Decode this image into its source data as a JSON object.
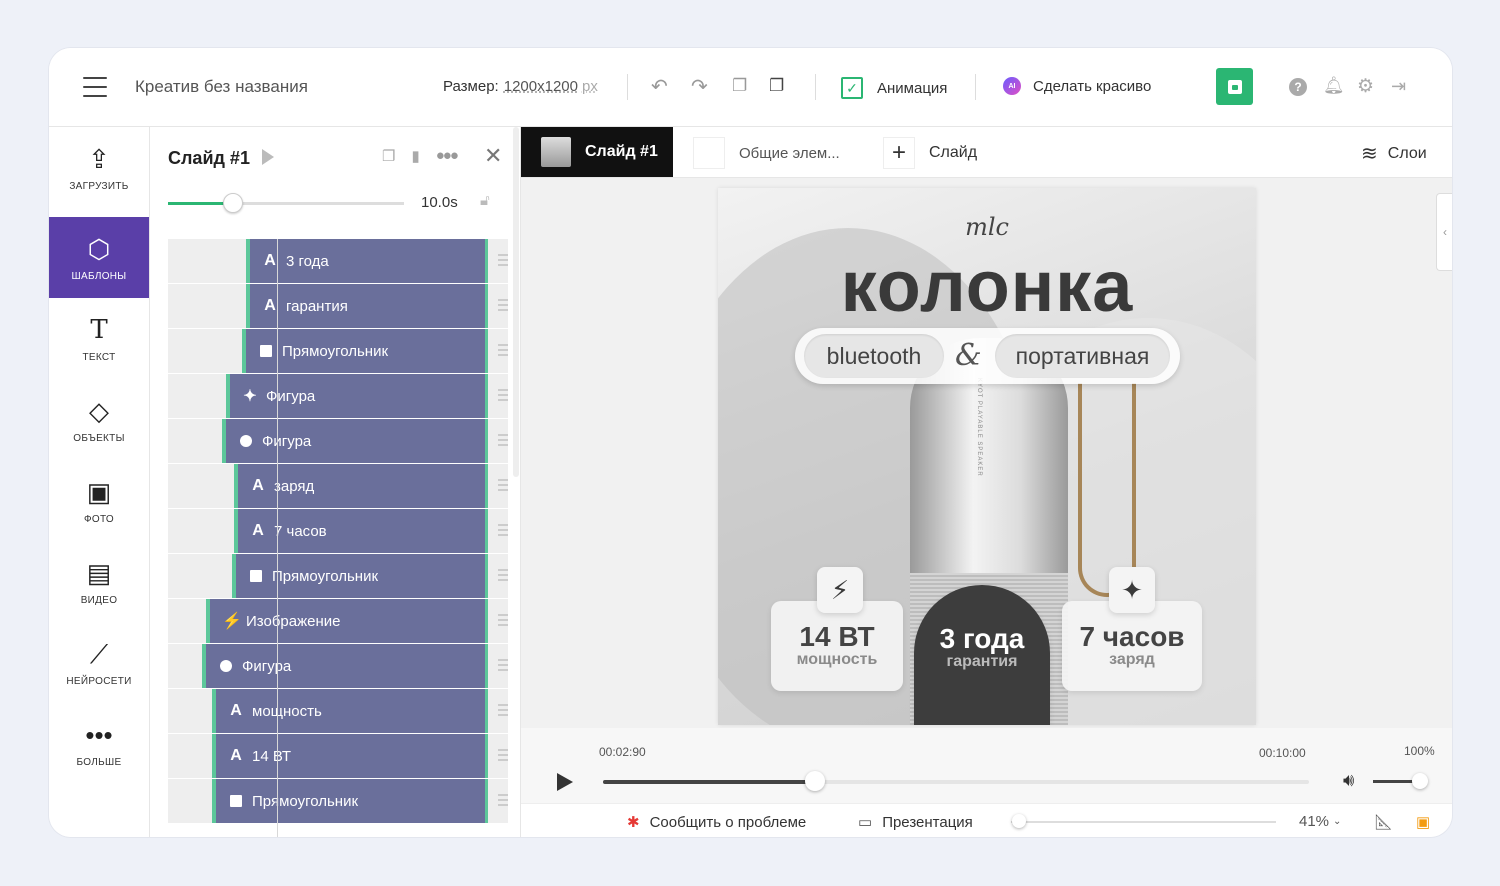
{
  "topbar": {
    "title": "Креатив без названия",
    "size_label": "Размер:",
    "size_value": "1200x1200",
    "size_unit": "px",
    "animation_label": "Анимация",
    "ai_badge": "AI",
    "make_pretty_label": "Сделать красиво",
    "accent_color": "#2bb673"
  },
  "sidebar": {
    "items": [
      {
        "label": "ЗАГРУЗИТЬ",
        "icon": "upload-icon"
      },
      {
        "label": "ШАБЛОНЫ",
        "icon": "templates-icon",
        "active": true
      },
      {
        "label": "ТЕКСТ",
        "icon": "text-icon"
      },
      {
        "label": "ОБЪЕКТЫ",
        "icon": "objects-icon"
      },
      {
        "label": "ФОТО",
        "icon": "photo-icon"
      },
      {
        "label": "ВИДЕО",
        "icon": "video-icon"
      },
      {
        "label": "НЕЙРОСЕТИ",
        "icon": "magic-wand-icon"
      },
      {
        "label": "БОЛЬШЕ",
        "icon": "more-icon"
      }
    ],
    "active_color": "#5a3fa8"
  },
  "layers_panel": {
    "title": "Слайд #1",
    "duration": "10.0s",
    "duration_fraction": 0.27,
    "layers": [
      {
        "type": "text",
        "glyph": "A",
        "name": "3 года"
      },
      {
        "type": "text",
        "glyph": "A",
        "name": "гарантия"
      },
      {
        "type": "rect",
        "name": "Прямоугольник"
      },
      {
        "type": "star",
        "glyph": "✦",
        "name": "Фигура"
      },
      {
        "type": "circle",
        "name": "Фигура"
      },
      {
        "type": "text",
        "glyph": "A",
        "name": "заряд"
      },
      {
        "type": "text",
        "glyph": "A",
        "name": "7 часов"
      },
      {
        "type": "rect",
        "name": "Прямоугольник"
      },
      {
        "type": "image",
        "glyph": "⚡",
        "name": "Изображение"
      },
      {
        "type": "circle",
        "name": "Фигура"
      },
      {
        "type": "text",
        "glyph": "A",
        "name": "мощность"
      },
      {
        "type": "text",
        "glyph": "A",
        "name": "14 ВТ"
      },
      {
        "type": "rect",
        "name": "Прямоугольник"
      }
    ],
    "layer_color": "#6a6f9b",
    "layer_edge_color": "#5cc79a"
  },
  "tabs": {
    "active": "Слайд #1",
    "common": "Общие элем...",
    "add_slide": "Слайд",
    "layers": "Слои"
  },
  "poster": {
    "brand": "mlc",
    "headline": "колонка",
    "pill_left": "bluetooth",
    "ampersand": "&",
    "pill_right": "портативная",
    "speaker_text": "KYOT PLAYABLE SPEAKER",
    "cards": [
      {
        "value": "14 ВТ",
        "sub": "мощность",
        "icon": "lightning-icon"
      },
      {
        "value": "3 года",
        "sub": "гарантия"
      },
      {
        "value": "7 часов",
        "sub": "заряд",
        "icon": "sparkle-icon"
      }
    ]
  },
  "timeline": {
    "current": "00:02:90",
    "total": "00:10:00",
    "volume": "100%",
    "progress_fraction": 0.3
  },
  "bottombar": {
    "report": "Сообщить о проблеме",
    "presentation": "Презентация",
    "zoom": "41%",
    "zoom_fraction": 0.03
  }
}
